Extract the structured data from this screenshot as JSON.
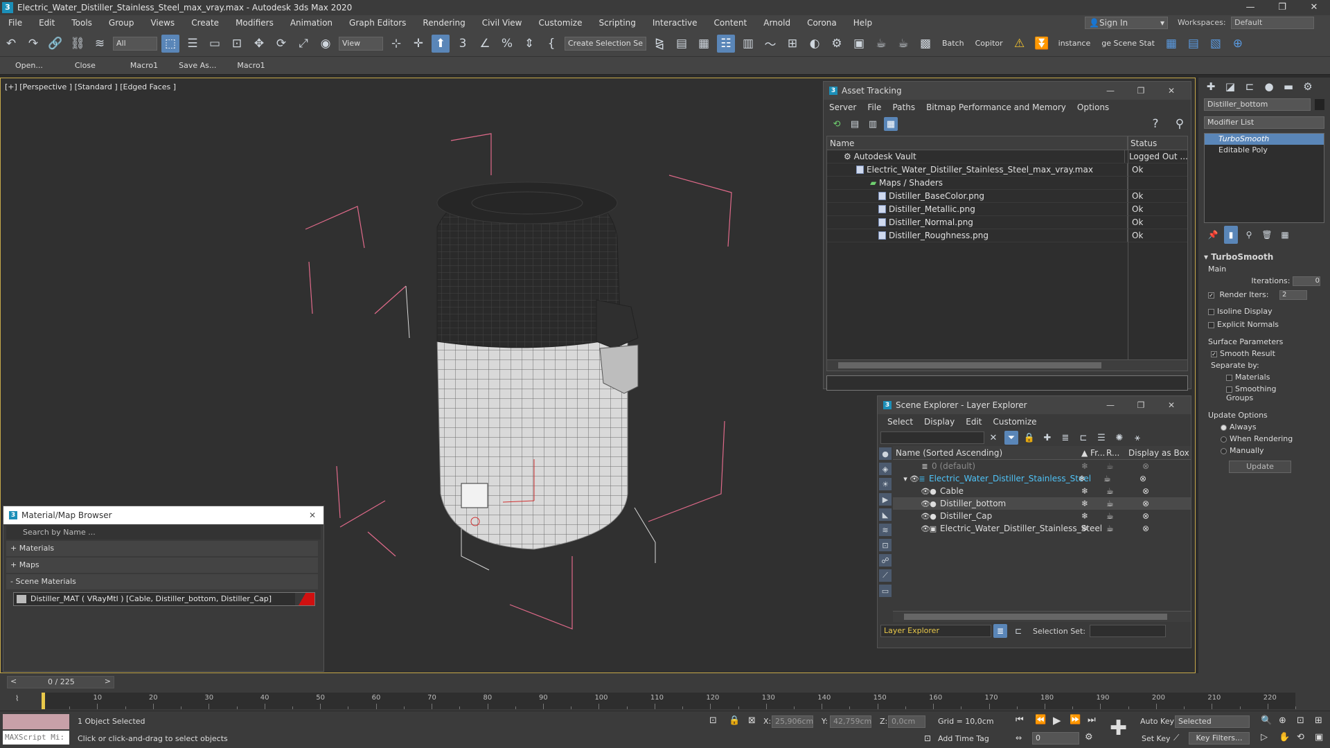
{
  "window": {
    "title": "Electric_Water_Distiller_Stainless_Steel_max_vray.max - Autodesk 3ds Max 2020",
    "app_icon": "3",
    "controls": [
      "—",
      "❐",
      "✕"
    ]
  },
  "menu": [
    "File",
    "Edit",
    "Tools",
    "Group",
    "Views",
    "Create",
    "Modifiers",
    "Animation",
    "Graph Editors",
    "Rendering",
    "Civil View",
    "Customize",
    "Scripting",
    "Interactive",
    "Content",
    "Arnold",
    "Corona",
    "Help"
  ],
  "account": {
    "sign_in": "Sign In",
    "workspaces_label": "Workspaces:",
    "workspace": "Default"
  },
  "toolbar": {
    "filter": "All",
    "refcoord": "View",
    "selection_set": "Create Selection Se",
    "batch": "Batch",
    "copitor": "Copitor",
    "instance": "instance",
    "scene_stat": "ge Scene Stat"
  },
  "macrobar": [
    "Open...",
    "Close",
    "Macro1",
    "Save As...",
    "Macro1"
  ],
  "viewport": {
    "label": "[+] [Perspective ] [Standard ] [Edged Faces ]"
  },
  "asset_tracking": {
    "title": "Asset Tracking",
    "menu": [
      "Server",
      "File",
      "Paths",
      "Bitmap Performance and Memory",
      "Options"
    ],
    "columns": [
      "Name",
      "Status"
    ],
    "rows": [
      {
        "name": "Autodesk Vault",
        "status": "Logged Out ..."
      },
      {
        "name": "Electric_Water_Distiller_Stainless_Steel_max_vray.max",
        "status": "Ok"
      },
      {
        "name": "Maps / Shaders",
        "status": ""
      },
      {
        "name": "Distiller_BaseColor.png",
        "status": "Ok"
      },
      {
        "name": "Distiller_Metallic.png",
        "status": "Ok"
      },
      {
        "name": "Distiller_Normal.png",
        "status": "Ok"
      },
      {
        "name": "Distiller_Roughness.png",
        "status": "Ok"
      }
    ]
  },
  "scene_explorer": {
    "title": "Scene Explorer - Layer Explorer",
    "menu": [
      "Select",
      "Display",
      "Edit",
      "Customize"
    ],
    "columns": [
      "Name (Sorted Ascending)",
      "▲ Fr...",
      "R...",
      "Display as Box"
    ],
    "rows": [
      {
        "name": "0 (default)"
      },
      {
        "name": "Electric_Water_Distiller_Stainless_Steel"
      },
      {
        "name": "Cable"
      },
      {
        "name": "Distiller_bottom"
      },
      {
        "name": "Distiller_Cap"
      },
      {
        "name": "Electric_Water_Distiller_Stainless_Steel"
      }
    ],
    "footer_mode": "Layer Explorer",
    "selection_set_label": "Selection Set:"
  },
  "material_browser": {
    "title": "Material/Map Browser",
    "search_placeholder": "Search by Name ...",
    "groups": [
      "+ Materials",
      "+ Maps",
      "- Scene Materials"
    ],
    "item": "Distiller_MAT  ( VRayMtl )  [Cable, Distiller_bottom, Distiller_Cap]"
  },
  "command_panel": {
    "object_name": "Distiller_bottom",
    "modifier_list": "Modifier List",
    "stack": [
      "TurboSmooth",
      "Editable Poly"
    ],
    "rollout": "TurboSmooth",
    "main": "Main",
    "iterations_label": "Iterations:",
    "iterations": "0",
    "render_iters_label": "Render Iters:",
    "render_iters": "2",
    "isoline": "Isoline Display",
    "explicit": "Explicit Normals",
    "surface": "Surface Parameters",
    "smooth_result": "Smooth Result",
    "separate_by": "Separate by:",
    "materials": "Materials",
    "smoothing_groups": "Smoothing Groups",
    "update_options": "Update Options",
    "always": "Always",
    "when_rendering": "When Rendering",
    "manually": "Manually",
    "update": "Update"
  },
  "timeline": {
    "frame": "0 / 225",
    "ticks": [
      "10",
      "20",
      "30",
      "40",
      "50",
      "60",
      "70",
      "80",
      "90",
      "100",
      "110",
      "120",
      "130",
      "140",
      "150",
      "160",
      "170",
      "180",
      "190",
      "200",
      "210",
      "220"
    ]
  },
  "status": {
    "maxscript": "MAXScript Mi:",
    "selected": "1 Object Selected",
    "prompt": "Click or click-and-drag to select objects",
    "x_label": "X:",
    "x": "25,906cm",
    "y_label": "Y:",
    "y": "42,759cm",
    "z_label": "Z:",
    "z": "0,0cm",
    "grid": "Grid = 10,0cm",
    "add_time_tag": "Add Time Tag",
    "auto_key": "Auto Key",
    "set_key": "Set Key",
    "key_mode": "Selected",
    "key_filters": "Key Filters...",
    "frame_field": "0"
  }
}
